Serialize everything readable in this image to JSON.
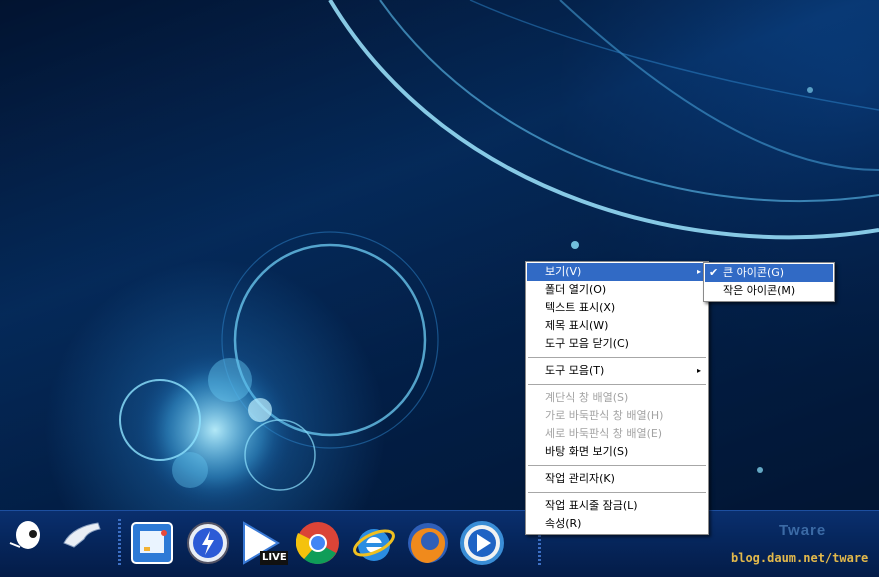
{
  "context_menu": {
    "items": [
      {
        "label": "보기(V)",
        "has_submenu": true,
        "selected": true
      },
      {
        "label": "폴더 열기(O)"
      },
      {
        "label": "텍스트 표시(X)"
      },
      {
        "label": "제목 표시(W)"
      },
      {
        "label": "도구 모음 닫기(C)"
      },
      {
        "label": "도구 모음(T)",
        "has_submenu": true
      },
      {
        "label": "계단식 창 배열(S)",
        "disabled": true
      },
      {
        "label": "가로 바둑판식 창 배열(H)",
        "disabled": true
      },
      {
        "label": "세로 바둑판식 창 배열(E)",
        "disabled": true
      },
      {
        "label": "바탕 화면 보기(S)"
      },
      {
        "label": "작업 관리자(K)"
      },
      {
        "label": "작업 표시줄 잠금(L)"
      },
      {
        "label": "속성(R)"
      }
    ]
  },
  "submenu": {
    "items": [
      {
        "label": "큰 아이콘(G)",
        "checked": true,
        "selected": true
      },
      {
        "label": "작은 아이콘(M)"
      }
    ]
  },
  "icons": {
    "submenu_arrow": "▸",
    "check": "✔"
  },
  "taskbar": {
    "live_badge": "LIVE"
  },
  "watermark": {
    "title": "Tware",
    "url": "blog.daum.net/tware"
  },
  "colors": {
    "highlight": "#316ac5",
    "taskbar": "#06275e"
  }
}
